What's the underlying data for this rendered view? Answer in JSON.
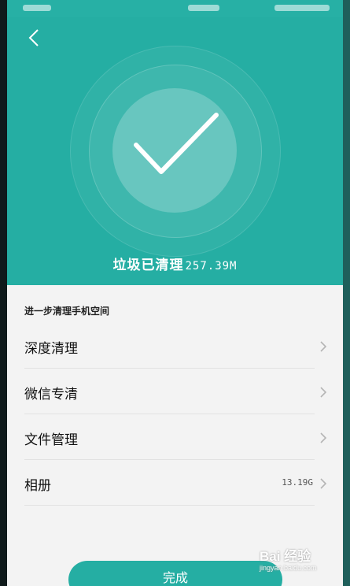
{
  "header": {
    "back_icon": "chevron-left-icon",
    "summary_label": "垃圾已清理",
    "summary_size": "257.39M"
  },
  "colors": {
    "accent": "#25aea3",
    "list_background": "#f3f3f3"
  },
  "list": {
    "section_title": "进一步清理手机空间",
    "items": [
      {
        "label": "深度清理",
        "value": ""
      },
      {
        "label": "微信专清",
        "value": ""
      },
      {
        "label": "文件管理",
        "value": ""
      },
      {
        "label": "相册",
        "value": "13.19G"
      }
    ]
  },
  "footer": {
    "done_label": "完成"
  },
  "watermark": {
    "main": "Bai 经验",
    "sub": "jingyan.baidu.com"
  }
}
